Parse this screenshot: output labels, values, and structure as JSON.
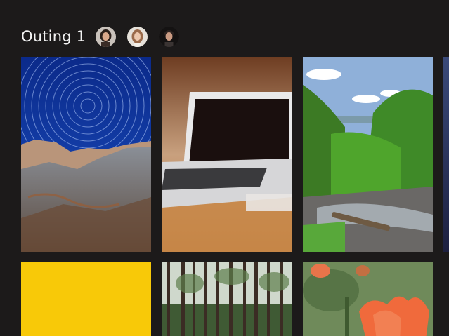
{
  "album": {
    "title": "Outing 1"
  },
  "members": [
    {
      "avatar_icon": "person-avatar-woman-dark-hair"
    },
    {
      "avatar_icon": "person-avatar-woman-light-hair"
    },
    {
      "avatar_icon": "person-avatar-man"
    }
  ],
  "photos": [
    {
      "icon": "photo-star-trails-rocks"
    },
    {
      "icon": "photo-laptop-on-desk"
    },
    {
      "icon": "photo-forest-waterfall"
    },
    {
      "icon": "photo-night-sky-partial"
    },
    {
      "icon": "photo-yellow-texture"
    },
    {
      "icon": "photo-pine-forest"
    },
    {
      "icon": "photo-orange-tulips"
    }
  ],
  "colors": {
    "background": "#1c1a1a",
    "title_text": "#f2f2f2"
  }
}
